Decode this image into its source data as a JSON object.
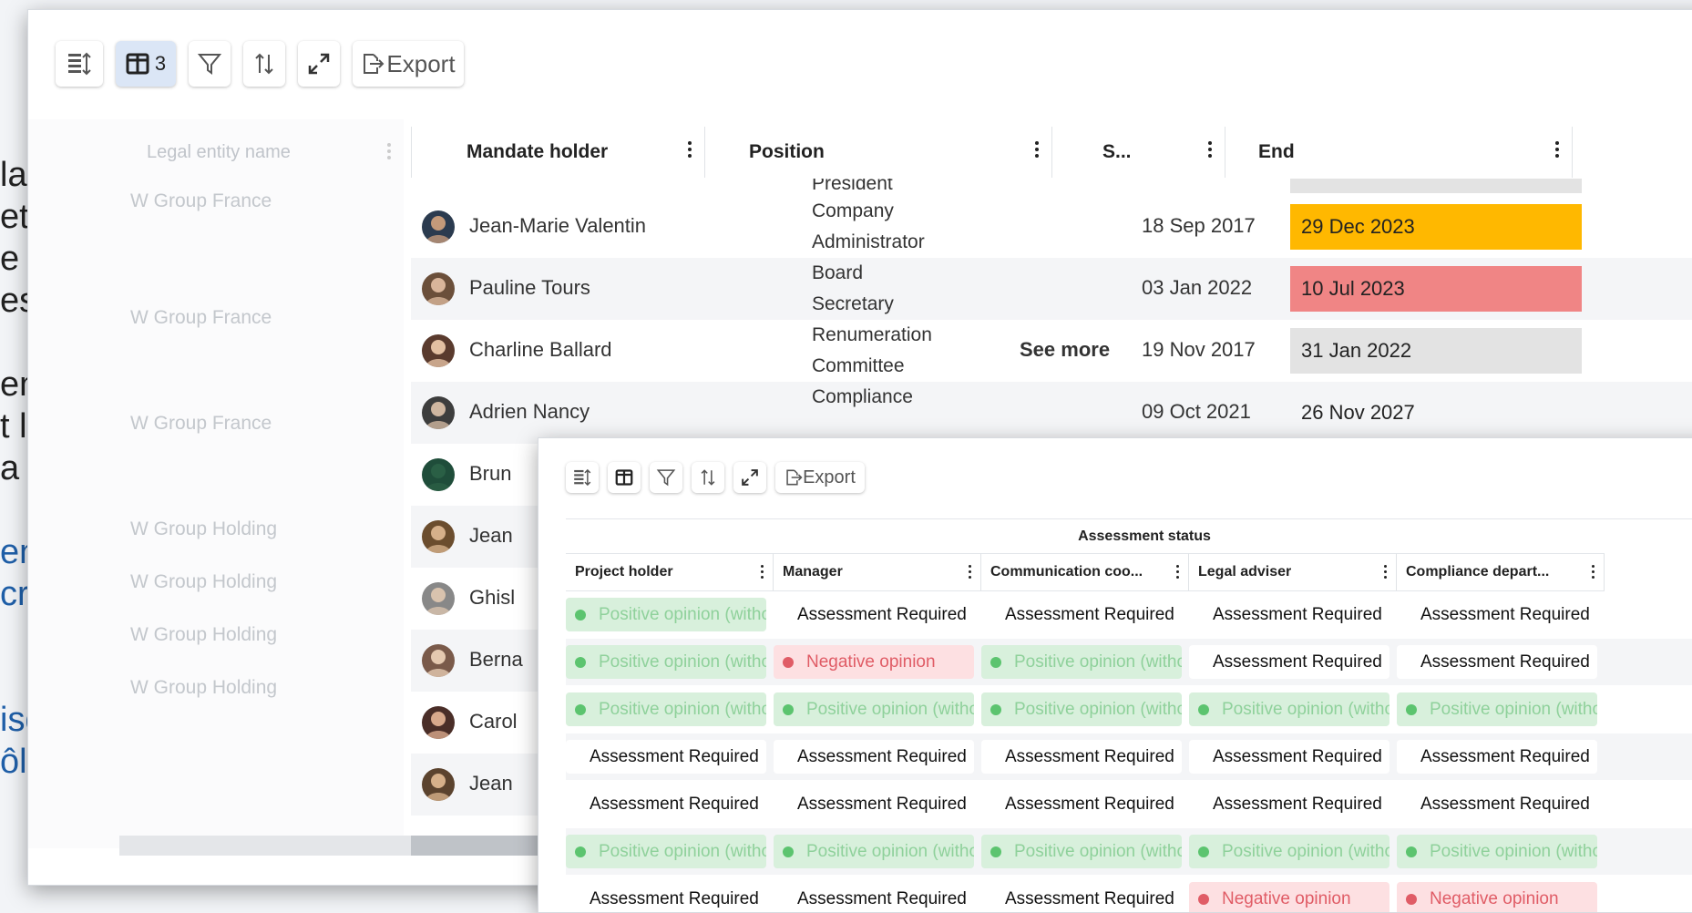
{
  "background_text": {
    "lines": [
      "la volée sont",
      "et valorisables, au",
      "e la plateforme au",
      "ess intelligences.",
      "ent vos risques. Vous",
      "t l’auditablité de vos",
      "a reportabilité.",
      "en charge réduisent de",
      "cré à la consolidation",
      "isques. Vous réduisez",
      "ôle."
    ]
  },
  "main_panel": {
    "toolbar": {
      "columns_count": "3",
      "export_label": "Export"
    },
    "headers": {
      "legal_entity": "Legal entity name",
      "mandate_holder": "Mandate holder",
      "position": "Position",
      "start": "S...",
      "end": "End"
    },
    "partial_top_position": "President",
    "legal_entities": [
      "W Group France",
      "W Group France",
      "W Group France",
      "W Group Holding",
      "W Group Holding",
      "W Group Holding",
      "W Group Holding"
    ],
    "rows": [
      {
        "name": "Jean-Marie Valentin",
        "position": [
          "Company",
          "Administrator"
        ],
        "start": "18 Sep 2017",
        "end": "29 Dec 2023",
        "end_color": "#ffb800",
        "see_more": ""
      },
      {
        "name": "Pauline Tours",
        "position": [
          "Board",
          "Secretary"
        ],
        "start": "03 Jan 2022",
        "end": "10 Jul 2023",
        "end_color": "#f08585",
        "see_more": ""
      },
      {
        "name": "Charline Ballard",
        "position": [
          "Renumeration",
          "Committee"
        ],
        "start": "19 Nov 2017",
        "end": "31 Jan 2022",
        "end_color": "#e3e3e3",
        "see_more": "See more"
      },
      {
        "name": "Adrien Nancy",
        "position": [
          "Compliance",
          ""
        ],
        "start": "09 Oct 2021",
        "end": "26 Nov 2027",
        "end_color": "",
        "see_more": ""
      },
      {
        "name": "Brun",
        "position": [
          "",
          ""
        ],
        "start": "",
        "end": "",
        "end_color": "",
        "see_more": ""
      },
      {
        "name": "Jean",
        "position": [
          "",
          ""
        ],
        "start": "",
        "end": "",
        "end_color": "",
        "see_more": ""
      },
      {
        "name": "Ghisl",
        "position": [
          "",
          ""
        ],
        "start": "",
        "end": "",
        "end_color": "",
        "see_more": ""
      },
      {
        "name": "Berna",
        "position": [
          "",
          ""
        ],
        "start": "",
        "end": "",
        "end_color": "",
        "see_more": ""
      },
      {
        "name": "Carol",
        "position": [
          "",
          ""
        ],
        "start": "",
        "end": "",
        "end_color": "",
        "see_more": ""
      },
      {
        "name": "Jean",
        "position": [
          "",
          ""
        ],
        "start": "",
        "end": "",
        "end_color": "",
        "see_more": ""
      }
    ]
  },
  "second_panel": {
    "toolbar": {
      "export_label": "Export"
    },
    "group_header": "Assessment status",
    "headers": [
      "Project holder",
      "Manager",
      "Communication coo...",
      "Legal adviser",
      "Compliance depart..."
    ],
    "labels": {
      "pos": "Positive opinion (witho",
      "neg": "Negative opinion",
      "req": "Assessment Required",
      "neg_partial": "Negative opinion"
    },
    "rows": [
      [
        "pos",
        "req",
        "req",
        "req",
        "req"
      ],
      [
        "pos",
        "neg",
        "pos",
        "req",
        "req"
      ],
      [
        "pos",
        "pos",
        "pos",
        "pos",
        "pos"
      ],
      [
        "req",
        "req",
        "req",
        "req",
        "req"
      ],
      [
        "req",
        "req",
        "req",
        "req",
        "req"
      ],
      [
        "pos",
        "pos",
        "pos",
        "pos",
        "pos"
      ],
      [
        "req",
        "req",
        "req",
        "neg",
        "neg"
      ]
    ]
  },
  "colors": {
    "accent": "#dbe6f6",
    "positive": "#5cc46f",
    "negative": "#e05c66",
    "link_blue": "#1f5fa8"
  }
}
